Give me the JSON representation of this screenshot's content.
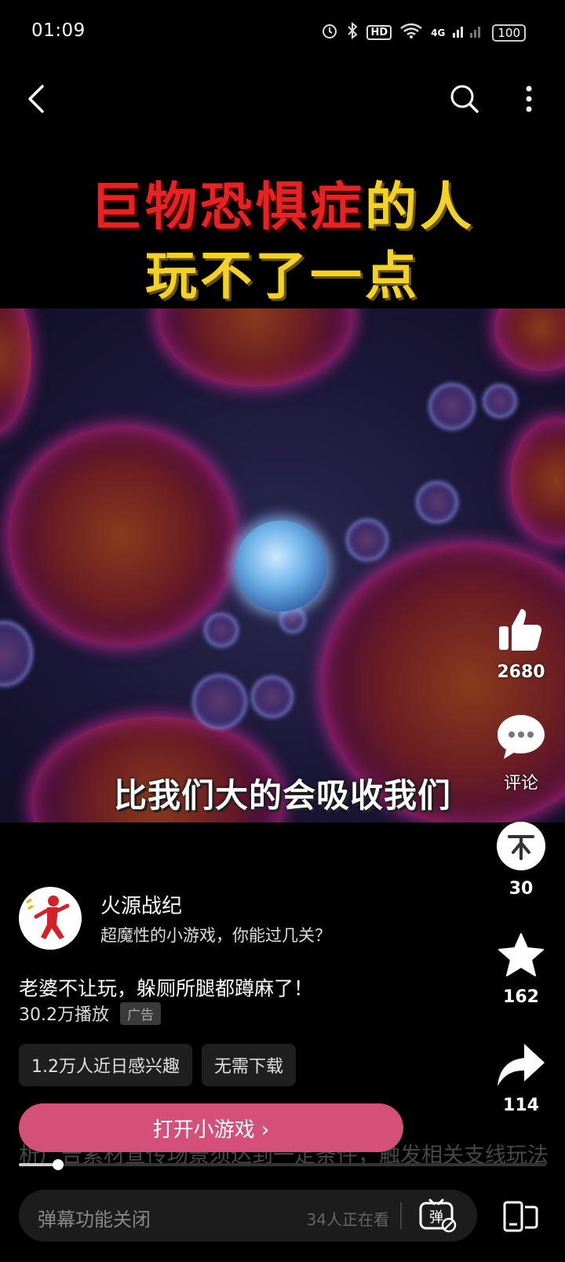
{
  "status_bar": {
    "time": "01:09",
    "hd": "HD",
    "network": "4G",
    "battery": "100"
  },
  "video": {
    "title_red": "巨物恐惧症",
    "title_yellow_1": "的人",
    "title_yellow_2": "玩不了一点",
    "subtitle": "比我们大的会吸收我们"
  },
  "rail": {
    "likes": "2680",
    "comments_label": "评论",
    "coins": "30",
    "favorites": "162",
    "shares": "114"
  },
  "info": {
    "author": "火源战纪",
    "description": "超魔性的小游戏，你能过几关？",
    "caption": "老婆不让玩，躲厕所腿都蹲麻了！",
    "plays": "30.2万播放",
    "ad_label": "广告"
  },
  "chips": [
    "1.2万人近日感兴趣",
    "无需下载"
  ],
  "cta": {
    "label": "打开小游戏 ›"
  },
  "danmaku_scroll": "析广告素材宣传场景须达到一定条件，触发相关支线玩法",
  "progress": {
    "fraction": 0.075
  },
  "bottom_bar": {
    "input_placeholder": "弹幕功能关闭",
    "watching": "34人正在看"
  },
  "colors": {
    "cta": "#d4507a",
    "title_red": "#e52322",
    "title_yellow": "#f2d22a"
  },
  "icons": {
    "back": "back-arrow-icon",
    "search": "search-icon",
    "more": "more-vertical-icon",
    "like": "thumbs-up-icon",
    "comment": "comment-bubble-icon",
    "coin": "coin-icon",
    "favorite": "star-icon",
    "share": "share-arrow-icon",
    "danmaku": "danmaku-toggle-icon",
    "screen": "screen-mode-icon"
  }
}
